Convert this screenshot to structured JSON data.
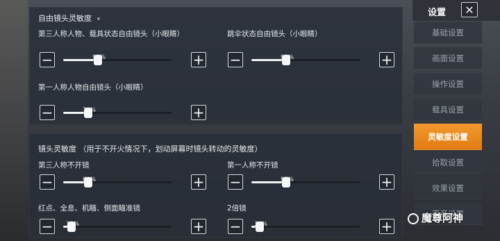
{
  "sidebar": {
    "title": "设置",
    "items": [
      {
        "label": "基础设置",
        "active": false
      },
      {
        "label": "画面设置",
        "active": false
      },
      {
        "label": "操作设置",
        "active": false
      },
      {
        "label": "载具设置",
        "active": false
      },
      {
        "label": "灵敏度设置",
        "active": true
      },
      {
        "label": "拾取设置",
        "active": false
      },
      {
        "label": "效果设置",
        "active": false
      },
      {
        "label": "声音设置",
        "active": false
      }
    ]
  },
  "section1": {
    "title": "自由镜头灵敏度",
    "sliders": [
      {
        "label": "第三人称人物、载具状态自由镜头（小眼睛）",
        "value": 97,
        "value_text": "97%",
        "fraction": 0.32
      },
      {
        "label": "跳伞状态自由镜头（小眼睛）",
        "value": 97,
        "value_text": "97%",
        "fraction": 0.32
      },
      {
        "label": "第一人称人物自由镜头（小眼睛）",
        "value": 70,
        "value_text": "70%",
        "fraction": 0.23
      }
    ]
  },
  "section2": {
    "title": "镜头灵敏度  （用于不开火情况下，划动屏幕时镜头转动的灵敏度）",
    "sliders": [
      {
        "label": "第三人称不开镜",
        "value": 69,
        "value_text": "69%",
        "fraction": 0.23
      },
      {
        "label": "第一人称不开镜",
        "value": 97,
        "value_text": "97%",
        "fraction": 0.32
      },
      {
        "label": "红点、全息、机瞄、侧面瞄准镜",
        "value": 30,
        "value_text": "30%",
        "fraction": 0.08
      },
      {
        "label": "2倍镜",
        "value": 30,
        "value_text": "30%",
        "fraction": 0.08
      }
    ]
  },
  "controls": {
    "minus": "−",
    "plus": "+",
    "close": "✕"
  },
  "watermark": "魔尊阿神",
  "colors": {
    "accent": "#e98a20",
    "panel": "#282e38"
  }
}
